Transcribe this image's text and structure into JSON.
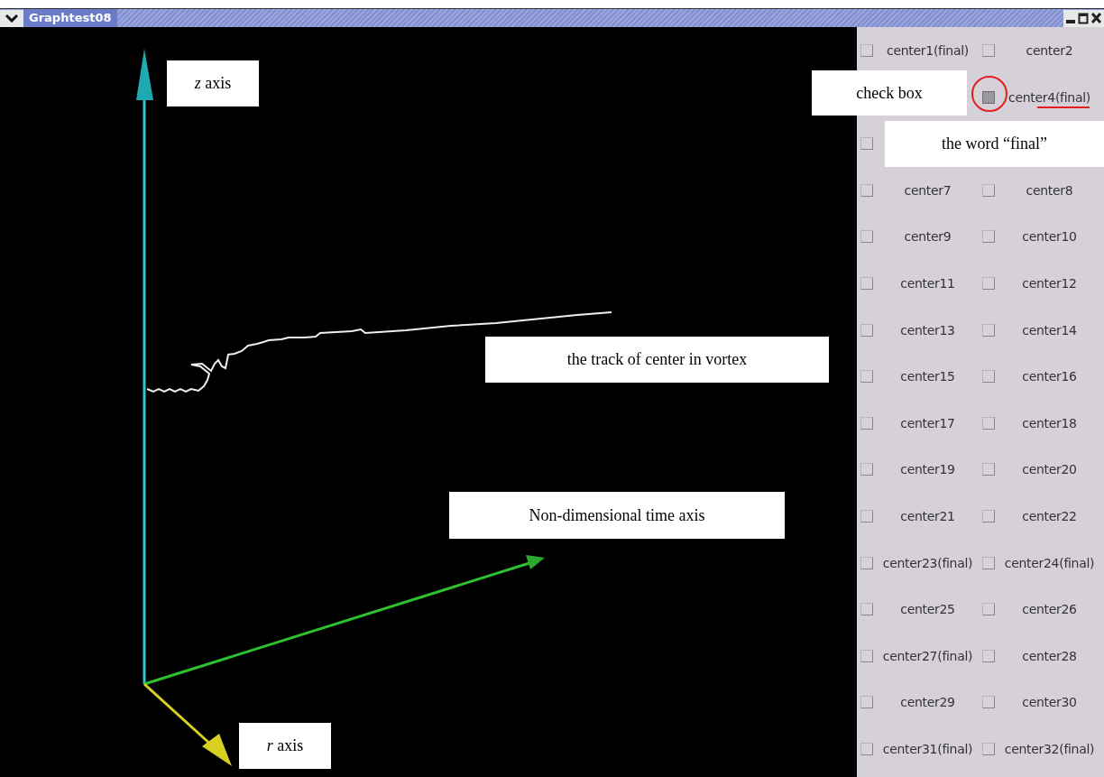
{
  "window": {
    "title": "Graphtest08"
  },
  "annotations": [
    {
      "kind": "axis",
      "text": "*z* axis"
    },
    {
      "kind": "checkbox",
      "text": "check box"
    },
    {
      "kind": "word",
      "text": "the word “final”"
    },
    {
      "kind": "track",
      "text": "the track of center in vortex"
    },
    {
      "kind": "time",
      "text": "Non-dimensional time axis"
    },
    {
      "kind": "raxis",
      "text": "*r* axis"
    }
  ],
  "panel": {
    "rows": [
      {
        "left": {
          "label": "center1(final)",
          "checked": false
        },
        "right": {
          "label": "center2",
          "checked": false
        }
      },
      {
        "right": {
          "label": "center4(final)",
          "checked": true
        }
      },
      {
        "left": {
          "checked": false
        }
      },
      {
        "left": {
          "label": "center7",
          "checked": false
        },
        "right": {
          "label": "center8",
          "checked": false
        }
      },
      {
        "left": {
          "label": "center9",
          "checked": false
        },
        "right": {
          "label": "center10",
          "checked": false
        }
      },
      {
        "left": {
          "label": "center11",
          "checked": false
        },
        "right": {
          "label": "center12",
          "checked": false
        }
      },
      {
        "left": {
          "label": "center13",
          "checked": false
        },
        "right": {
          "label": "center14",
          "checked": false
        }
      },
      {
        "left": {
          "label": "center15",
          "checked": false
        },
        "right": {
          "label": "center16",
          "checked": false
        }
      },
      {
        "left": {
          "label": "center17",
          "checked": false
        },
        "right": {
          "label": "center18",
          "checked": false
        }
      },
      {
        "left": {
          "label": "center19",
          "checked": false
        },
        "right": {
          "label": "center20",
          "checked": false
        }
      },
      {
        "left": {
          "label": "center21",
          "checked": false
        },
        "right": {
          "label": "center22",
          "checked": false
        }
      },
      {
        "left": {
          "label": "center23(final)",
          "checked": false
        },
        "right": {
          "label": "center24(final)",
          "checked": false
        }
      },
      {
        "left": {
          "label": "center25",
          "checked": false
        },
        "right": {
          "label": "center26",
          "checked": false
        }
      },
      {
        "left": {
          "label": "center27(final)",
          "checked": false
        },
        "right": {
          "label": "center28",
          "checked": false
        }
      },
      {
        "left": {
          "label": "center29",
          "checked": false
        },
        "right": {
          "label": "center30",
          "checked": false
        }
      },
      {
        "left": {
          "label": "center31(final)",
          "checked": false
        },
        "right": {
          "label": "center32(final)",
          "checked": false
        }
      }
    ]
  }
}
